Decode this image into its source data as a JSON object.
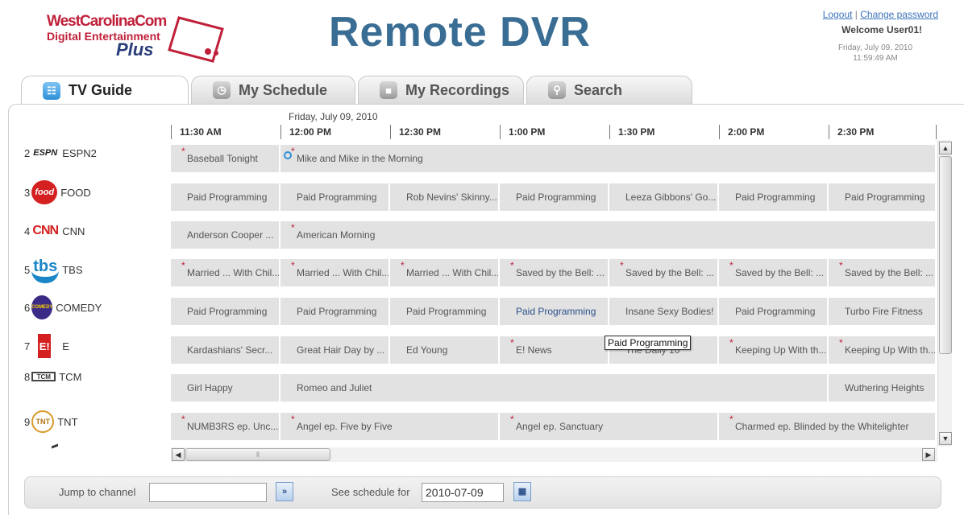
{
  "header": {
    "logo": {
      "line1": "WestCarolinaCom",
      "line2": "Digital Entertainment",
      "line3": "Plus"
    },
    "title": "Remote DVR",
    "logout": "Logout",
    "separator": "|",
    "change_password": "Change password",
    "welcome": "Welcome User01!",
    "date": "Friday, July 09, 2010",
    "time": "11:59:49 AM"
  },
  "tabs": [
    {
      "label": "TV Guide",
      "icon": "tv-guide-icon",
      "active": true
    },
    {
      "label": "My Schedule",
      "icon": "clock-icon",
      "active": false
    },
    {
      "label": "My Recordings",
      "icon": "recordings-icon",
      "active": false
    },
    {
      "label": "Search",
      "icon": "search-icon",
      "active": false
    }
  ],
  "guide": {
    "date_header": "Friday, July 09, 2010",
    "time_slots": [
      "11:30 AM",
      "12:00 PM",
      "12:30 PM",
      "1:00 PM",
      "1:30 PM",
      "2:00 PM",
      "2:30 PM"
    ],
    "tooltip": "Paid Programming",
    "channels": [
      {
        "number": "2",
        "logo": "ESPN",
        "name": "ESPN2"
      },
      {
        "number": "3",
        "logo": "food",
        "name": "FOOD"
      },
      {
        "number": "4",
        "logo": "CNN",
        "name": "CNN"
      },
      {
        "number": "5",
        "logo": "tbs",
        "name": "TBS"
      },
      {
        "number": "6",
        "logo": "COMEDY",
        "name": "COMEDY"
      },
      {
        "number": "7",
        "logo": "E!",
        "name": "E"
      },
      {
        "number": "8",
        "logo": "TCM",
        "name": "TCM"
      },
      {
        "number": "9",
        "logo": "TNT",
        "name": "TNT"
      }
    ],
    "rows": [
      [
        {
          "title": "Baseball Tonight",
          "rec": true
        },
        {
          "title": "Mike and Mike in the Morning",
          "rec": true,
          "scheduled": true
        }
      ],
      [
        {
          "title": "Paid Programming"
        },
        {
          "title": "Paid Programming"
        },
        {
          "title": "Rob Nevins' Skinny..."
        },
        {
          "title": "Paid Programming"
        },
        {
          "title": "Leeza Gibbons' Go..."
        },
        {
          "title": "Paid Programming"
        },
        {
          "title": "Paid Programming"
        }
      ],
      [
        {
          "title": "Anderson Cooper ..."
        },
        {
          "title": "American Morning",
          "rec": true
        }
      ],
      [
        {
          "title": "Married ... With Chil...",
          "rec": true
        },
        {
          "title": "Married ... With Chil...",
          "rec": true
        },
        {
          "title": "Married ... With Chil...",
          "rec": true
        },
        {
          "title": "Saved by the Bell: ...",
          "rec": true
        },
        {
          "title": "Saved by the Bell: ...",
          "rec": true
        },
        {
          "title": "Saved by the Bell: ...",
          "rec": true
        },
        {
          "title": "Saved by the Bell: ...",
          "rec": true
        }
      ],
      [
        {
          "title": "Paid Programming"
        },
        {
          "title": "Paid Programming"
        },
        {
          "title": "Paid Programming"
        },
        {
          "title": "Paid Programming"
        },
        {
          "title": "Insane Sexy Bodies!"
        },
        {
          "title": "Paid Programming"
        },
        {
          "title": "Turbo Fire Fitness"
        }
      ],
      [
        {
          "title": "Kardashians' Secr..."
        },
        {
          "title": "Great Hair Day by ..."
        },
        {
          "title": "Ed Young"
        },
        {
          "title": "E! News",
          "rec": true
        },
        {
          "title": "The Daily 10"
        },
        {
          "title": "Keeping Up With th...",
          "rec": true
        },
        {
          "title": "Keeping Up With th...",
          "rec": true
        }
      ],
      [
        {
          "title": "Girl Happy"
        },
        {
          "title": "Romeo and Juliet"
        },
        {
          "title": "Wuthering Heights"
        }
      ],
      [
        {
          "title": "NUMB3RS ep. Unc...",
          "rec": true
        },
        {
          "title": "Angel ep. Five by Five",
          "rec": true
        },
        {
          "title": "Angel ep. Sanctuary",
          "rec": true
        },
        {
          "title": "Charmed ep. Blinded by the Whitelighter",
          "rec": true
        }
      ]
    ]
  },
  "footer": {
    "jump_label": "Jump to channel",
    "jump_value": "",
    "jump_button": "»",
    "schedule_label": "See schedule for",
    "schedule_value": "2010-07-09",
    "calendar_icon": "calendar-icon"
  },
  "colors": {
    "title": "#3a6d94",
    "brand_red": "#c0203a",
    "link": "#3b73b9"
  }
}
